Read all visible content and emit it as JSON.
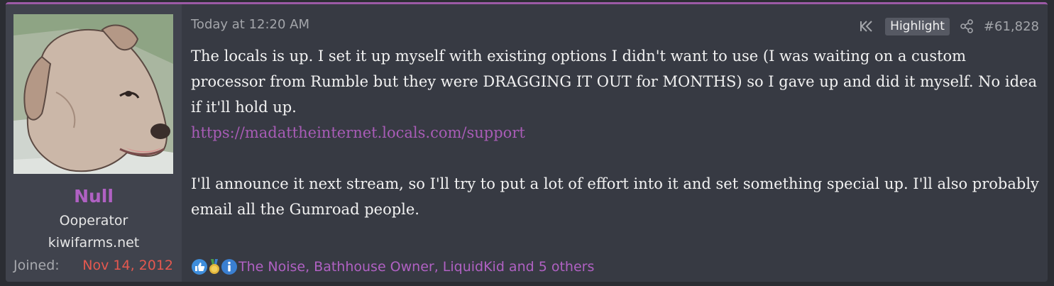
{
  "user": {
    "name": "Null",
    "title": "Ooperator",
    "banner": "kiwifarms.net",
    "joined_label": "Joined:",
    "joined_date": "Nov 14, 2012",
    "avatar_icon": "dog-avatar"
  },
  "post": {
    "date": "Today at 12:20 AM",
    "highlight_label": "Highlight",
    "post_number": "#61,828",
    "paragraph1": "The locals is up. I set it up myself with existing options I didn't want to use (I was waiting on a custom processor from Rumble but they were DRAGGING IT OUT for MONTHS) so I gave up and did it myself. No idea if it'll hold up.",
    "link": "https://madattheinternet.locals.com/support",
    "paragraph2": "I'll announce it next stream, so I'll try to put a lot of effort into it and set something special up. I'll also probably email all the Gumroad people."
  },
  "reactions": {
    "icons": [
      "thumbs-up-icon",
      "medal-icon",
      "info-icon"
    ],
    "text": "The Noise, Bathhouse Owner, LiquidKid and 5 others"
  },
  "colors": {
    "accent": "#9c5aa6",
    "username": "#b061c3",
    "joined_date": "#e5584f",
    "link": "#a85cb6"
  }
}
